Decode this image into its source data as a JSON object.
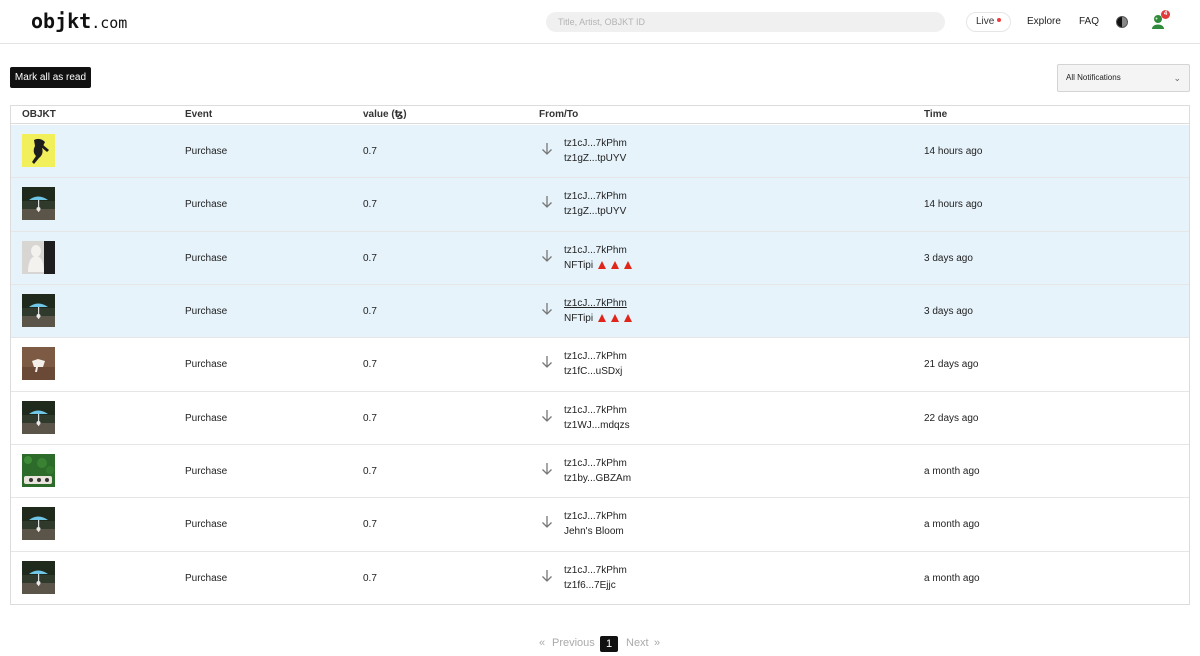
{
  "header": {
    "logo_brand": "objkt",
    "logo_tld": ".com",
    "search_placeholder": "Title, Artist, OBJKT ID",
    "live_label": "Live",
    "explore_label": "Explore",
    "faq_label": "FAQ",
    "notification_count": "4"
  },
  "toolbar": {
    "mark_all_label": "Mark all as read",
    "filter_selected": "All Notifications"
  },
  "table": {
    "columns": [
      "OBJKT",
      "Event",
      "value (ꜩ)",
      "From/To",
      "Time"
    ],
    "rows": [
      {
        "event": "Purchase",
        "value": "0.7",
        "from": "tz1cJ...7kPhm",
        "to": "tz1gZ...tpUYV",
        "time": "14 hours ago",
        "thumb": "yellow-figure"
      },
      {
        "event": "Purchase",
        "value": "0.7",
        "from": "tz1cJ...7kPhm",
        "to": "tz1gZ...tpUYV",
        "time": "14 hours ago",
        "thumb": "umbrella-garden"
      },
      {
        "event": "Purchase",
        "value": "0.7",
        "from": "tz1cJ...7kPhm",
        "to": "NFTipi",
        "time": "3 days ago",
        "thumb": "white-statue"
      },
      {
        "event": "Purchase",
        "value": "0.7",
        "from": "tz1cJ...7kPhm",
        "to": "NFTipi",
        "time": "3 days ago",
        "thumb": "umbrella-garden"
      },
      {
        "event": "Purchase",
        "value": "0.7",
        "from": "tz1cJ...7kPhm",
        "to": "tz1fC...uSDxj",
        "time": "21 days ago",
        "thumb": "brown-shape"
      },
      {
        "event": "Purchase",
        "value": "0.7",
        "from": "tz1cJ...7kPhm",
        "to": "tz1WJ...mdqzs",
        "time": "22 days ago",
        "thumb": "umbrella-garden"
      },
      {
        "event": "Purchase",
        "value": "0.7",
        "from": "tz1cJ...7kPhm",
        "to": "tz1by...GBZAm",
        "time": "a month ago",
        "thumb": "green-hedge"
      },
      {
        "event": "Purchase",
        "value": "0.7",
        "from": "tz1cJ...7kPhm",
        "to": "Jehn's Bloom",
        "time": "a month ago",
        "thumb": "umbrella-garden"
      },
      {
        "event": "Purchase",
        "value": "0.7",
        "from": "tz1cJ...7kPhm",
        "to": "tz1f6...7Ejjc",
        "time": "a month ago",
        "thumb": "umbrella-garden"
      }
    ]
  },
  "pagination": {
    "previous_label": "Previous",
    "current_page": "1",
    "next_label": "Next",
    "prev_chevron": "«",
    "next_chevron": "»"
  },
  "colors": {
    "unread_row": "#e6f3fb",
    "accent_red": "#e0261a",
    "button_dark": "#111111"
  }
}
